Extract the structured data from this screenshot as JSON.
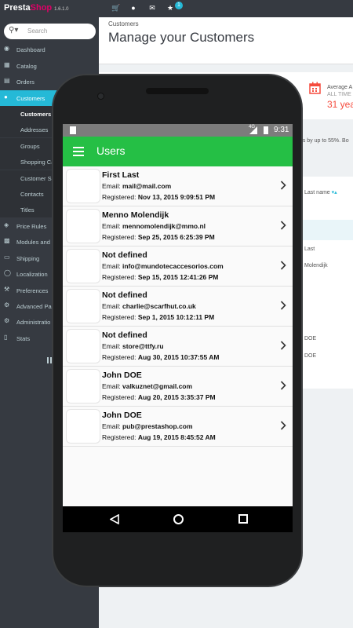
{
  "admin": {
    "logo_presta": "Presta",
    "logo_shop": "Shop",
    "version": "1.6.1.0",
    "notification_count": "1",
    "search_placeholder": "Search",
    "nav": [
      {
        "label": "Dashboard",
        "icon": "dashboard-icon"
      },
      {
        "label": "Catalog",
        "icon": "catalog-icon"
      },
      {
        "label": "Orders",
        "icon": "orders-icon"
      },
      {
        "label": "Customers",
        "icon": "users-icon"
      },
      {
        "label": "Price Rules",
        "icon": "tag-icon"
      },
      {
        "label": "Modules and",
        "icon": "puzzle-icon"
      },
      {
        "label": "Shipping",
        "icon": "truck-icon"
      },
      {
        "label": "Localization",
        "icon": "globe-icon"
      },
      {
        "label": "Preferences",
        "icon": "wrench-icon"
      },
      {
        "label": "Advanced Pa",
        "icon": "cogs-icon"
      },
      {
        "label": "Administratio",
        "icon": "gear-icon"
      },
      {
        "label": "Stats",
        "icon": "bar-chart-icon"
      }
    ],
    "subnav": [
      "Customers",
      "Addresses",
      "Groups",
      "Shopping Ca",
      "Customer Se",
      "Contacts",
      "Titles"
    ],
    "breadcrumb": "Customers",
    "page_title": "Manage your Customers",
    "kpi_title": "Average A",
    "kpi_sub": "ALL TIME",
    "kpi_value": "31 yea",
    "promo_text": "nts by up to 55%. Bo",
    "table_header_last": "Last name",
    "table_cells": [
      "Last",
      "Molendijk",
      "DOE",
      "DOE"
    ]
  },
  "phone": {
    "status_signal_label": "4G",
    "status_time": "9:31",
    "app_title": "Users",
    "email_label": "Email: ",
    "registered_label": "Registered: ",
    "users": [
      {
        "name": "First  Last",
        "email": "mail@mail.com",
        "registered": "Nov 13, 2015 9:09:51 PM"
      },
      {
        "name": "Menno Molendijk",
        "email": "mennomolendijk@mmo.nl",
        "registered": "Sep 25, 2015 6:25:39 PM"
      },
      {
        "name": "Not defined",
        "email": "info@mundotecaccesorios.com",
        "registered": "Sep 15, 2015 12:41:26 PM"
      },
      {
        "name": "Not defined",
        "email": "charlie@scarfhut.co.uk",
        "registered": "Sep 1, 2015 10:12:11 PM"
      },
      {
        "name": "Not defined",
        "email": "store@ttfy.ru",
        "registered": "Aug 30, 2015 10:37:55 AM"
      },
      {
        "name": "John DOE",
        "email": "valkuznet@gmail.com",
        "registered": "Aug 20, 2015 3:35:37 PM"
      },
      {
        "name": "John DOE",
        "email": "pub@prestashop.com",
        "registered": "Aug 19, 2015 8:45:52 AM"
      }
    ]
  },
  "colors": {
    "app_green": "#25bf45",
    "admin_dark": "#363a41",
    "admin_accent": "#25b9d7",
    "kpi_red": "#f54c3e"
  }
}
